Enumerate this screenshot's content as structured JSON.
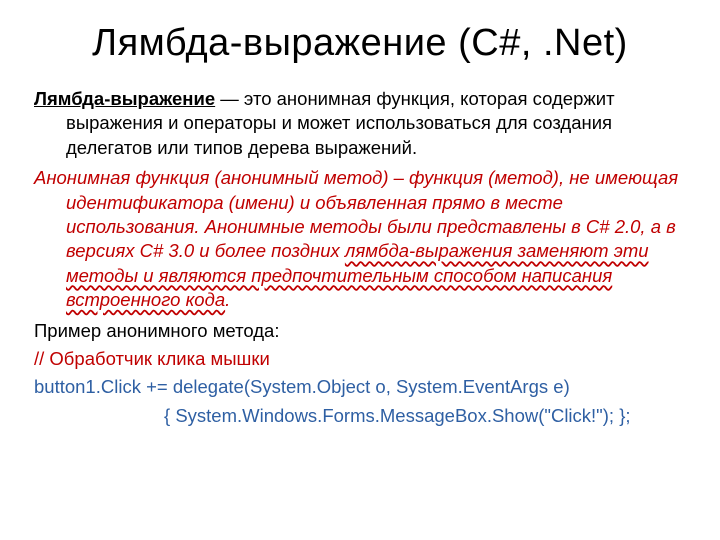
{
  "title": "Лямбда-выражение (C#, .Net)",
  "lambda_term": "Лямбда-выражение",
  "def_rest": " — это анонимная функция, которая содержит выражения и операторы и может использоваться для создания делегатов или типов дерева выражений.",
  "anon_pre": "Анонимная функция (анонимный метод) – функция (метод), не имеющая идентификатора (имени) и объявленная прямо в месте использования. Анонимные методы были представлены в C# 2.0, а в версиях C# 3.0 и более поздних ",
  "anon_wavy": "лямбда-выражения заменяют эти методы и являются предпочтительным способом написания встроенного кода",
  "anon_post": ".",
  "example_label": "Пример анонимного метода:",
  "code_comment": "// Обработчик клика мышки",
  "code_line1": "button1.Click += delegate(System.Object o, System.EventArgs e)",
  "code_line2": "{ System.Windows.Forms.MessageBox.Show(\"Click!\"); };"
}
